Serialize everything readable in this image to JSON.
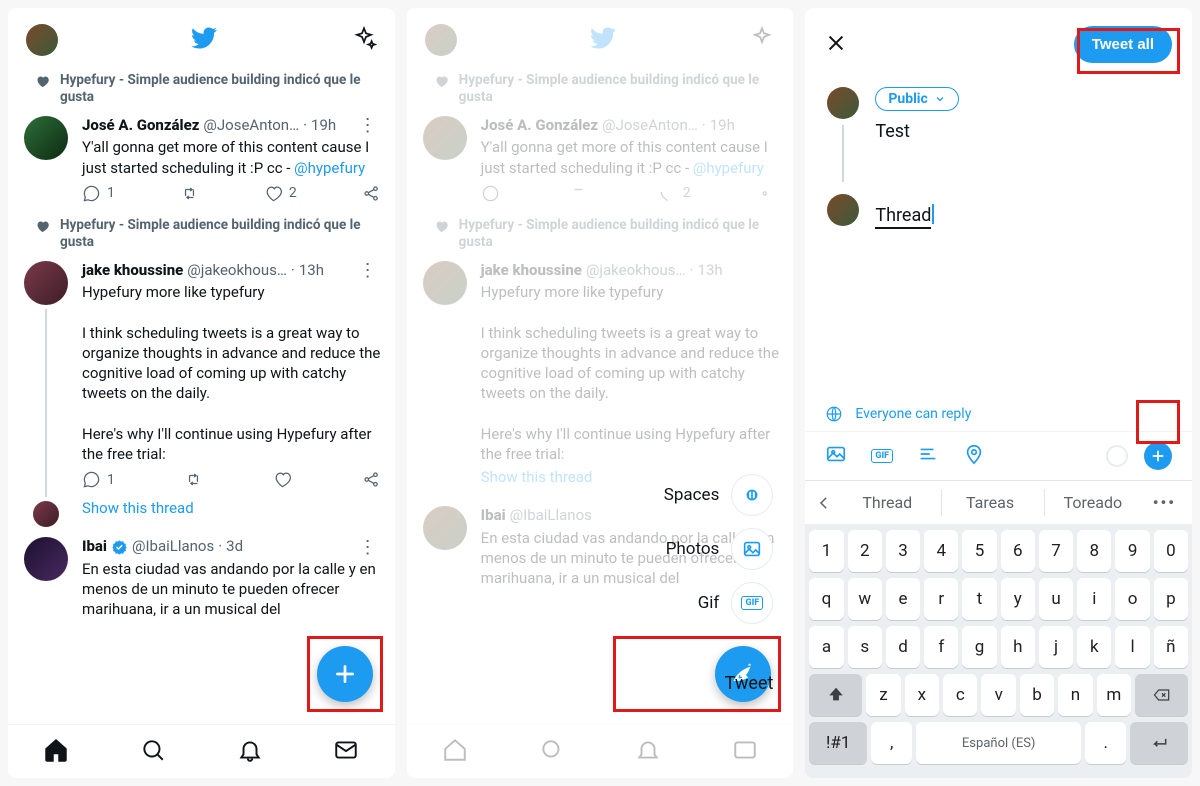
{
  "feed": {
    "like_context": "Hypefury - Simple audience building indicó que le gusta",
    "tweets": [
      {
        "name": "José A. González",
        "handle": "@JoseAnton…",
        "time": "19h",
        "body_pre": "Y'all gonna get more of this content cause I just started scheduling it :P  cc - ",
        "mention": "@hypefury",
        "reply_count": "1",
        "like_count": "2"
      },
      {
        "name": "jake khoussine",
        "handle": "@jakeokhous…",
        "time": "13h",
        "body": "Hypefury more like typefury\n\nI think scheduling tweets is a great way to organize thoughts in advance and reduce the cognitive load of coming up with catchy tweets on the daily.\n\nHere's why I'll continue using Hypefury after the free trial:",
        "reply_count": "1"
      },
      {
        "name": "Ibai",
        "handle": "@IbaiLlanos",
        "time": "3d",
        "body": "En esta ciudad vas andando por la calle y en menos de un minuto te pueden ofrecer marihuana, ir a un musical del"
      }
    ],
    "show_thread": "Show this thread"
  },
  "speed_dial": {
    "spaces": "Spaces",
    "photos": "Photos",
    "gif": "Gif",
    "tweet": "Tweet"
  },
  "compose": {
    "tweet_all": "Tweet all",
    "audience": "Public",
    "text1": "Test",
    "text2": "Thread",
    "reply_scope": "Everyone can reply"
  },
  "keyboard": {
    "suggestions": [
      "Thread",
      "Tareas",
      "Toreado"
    ],
    "row1": [
      "1",
      "2",
      "3",
      "4",
      "5",
      "6",
      "7",
      "8",
      "9",
      "0"
    ],
    "row2": [
      "q",
      "w",
      "e",
      "r",
      "t",
      "y",
      "u",
      "i",
      "o",
      "p"
    ],
    "row3": [
      "a",
      "s",
      "d",
      "f",
      "g",
      "h",
      "j",
      "k",
      "l",
      "ñ"
    ],
    "row4": [
      "z",
      "x",
      "c",
      "v",
      "b",
      "n",
      "m"
    ],
    "sym": "!#1",
    "lang": "Español (ES)"
  }
}
